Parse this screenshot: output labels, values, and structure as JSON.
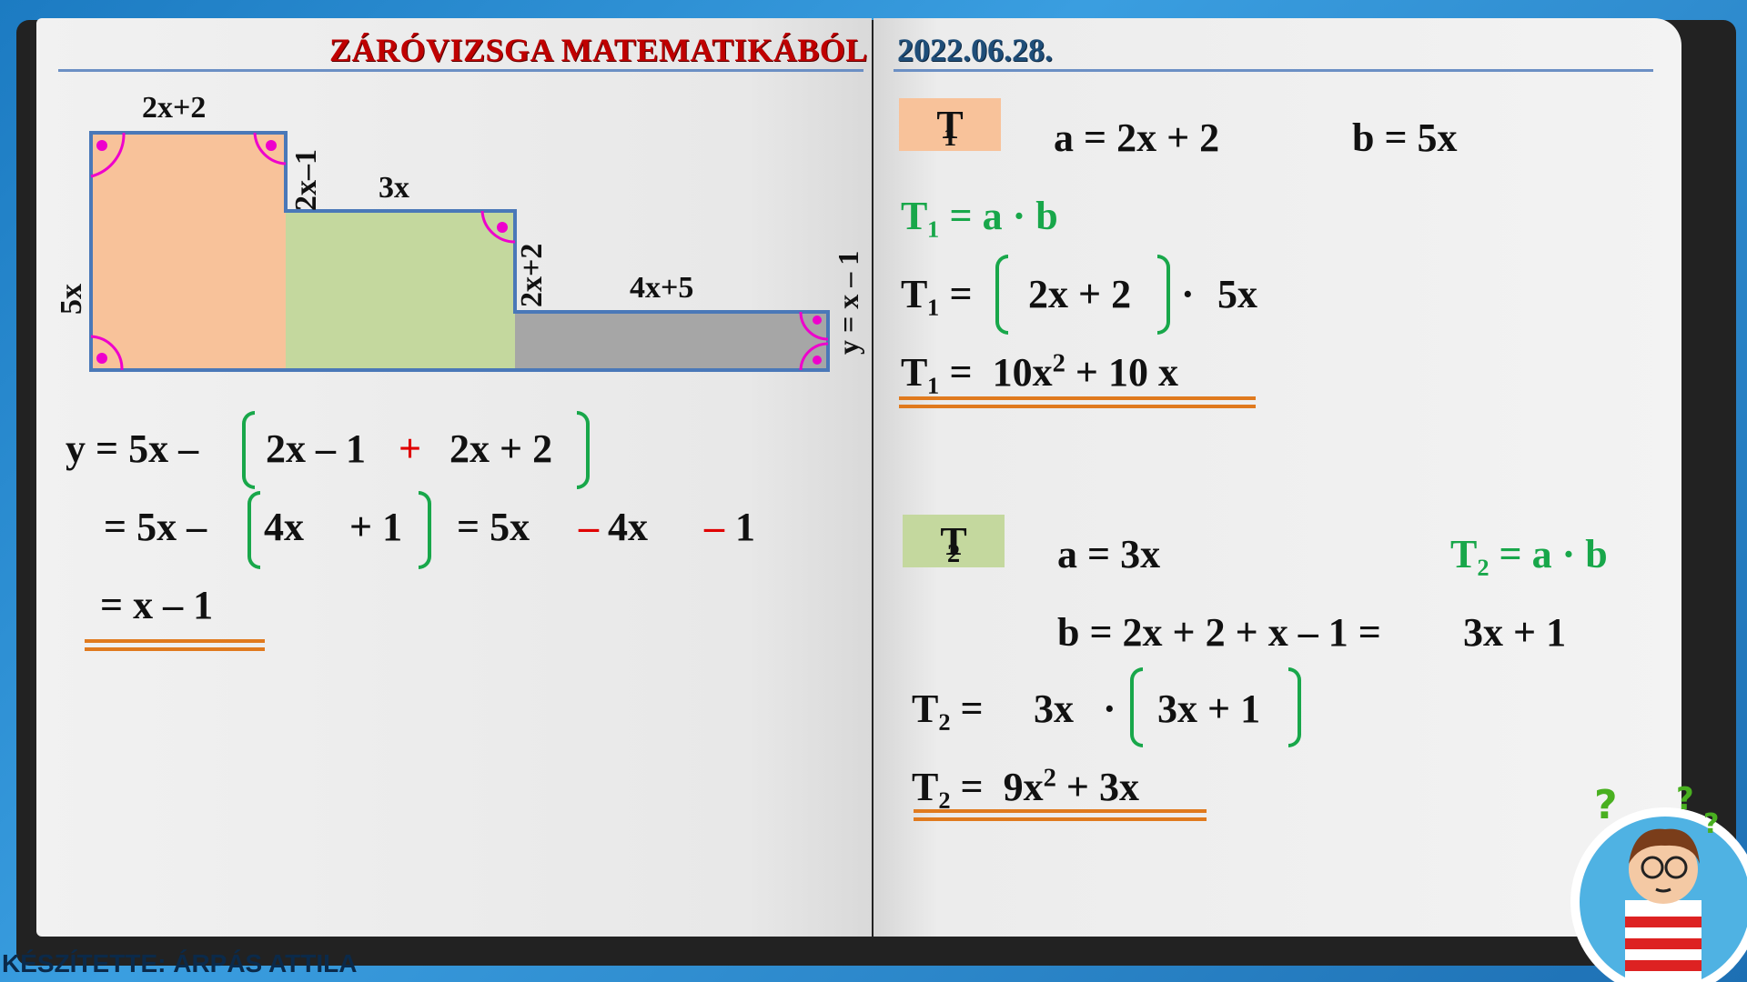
{
  "header": {
    "title": "ZÁRÓVIZSGA MATEMATIKÁBÓL",
    "date": "2022.06.28."
  },
  "figure": {
    "dim_top": "2x+2",
    "dim_step1_vertical": "2x–1",
    "dim_middle": "3x",
    "dim_step2_vertical": "2x+2",
    "dim_right": "4x+5",
    "dim_left": "5x",
    "dim_y": "y =  x – 1",
    "colors": {
      "t1": "#f8c29a",
      "t2": "#c4d89e",
      "t3": "#a6a6a6",
      "outline": "#4a78b8",
      "angle": "#ee00cc"
    }
  },
  "y_calc": {
    "line1": {
      "lhs": "y =  5x –",
      "a": "2x – 1",
      "op": "+",
      "b": "2x + 2"
    },
    "line2": {
      "lhs": "=  5x –",
      "a": "4x",
      "b": "+ 1",
      "eq": "=  5x",
      "m1": "–",
      "c": "4x",
      "m2": "–",
      "d": "1"
    },
    "line3": "=   x  – 1"
  },
  "t1": {
    "label": "T",
    "sub": "1",
    "a": "a = 2x + 2",
    "b": "b = 5x",
    "formula": "T₁ = a · b",
    "step1_lhs": "T₁ =",
    "step1_in": "2x + 2",
    "step1_dot": "·",
    "step1_rhs": "5x",
    "result_lhs": "T₁ =",
    "result_a": "10x",
    "result_exp": "2",
    "result_b": " + 10 x"
  },
  "t2": {
    "label": "T",
    "sub": "2",
    "a": "a = 3x",
    "formula": "T₂ = a · b",
    "b_line": "b = 2x +  2  + x – 1 =",
    "b_result": "3x  + 1",
    "step1_lhs": "T₂ =",
    "step1_a": "3x",
    "step1_dot": "·",
    "step1_in": "3x + 1",
    "result_lhs": "T₂ =",
    "result_a": "9x",
    "result_exp": "2",
    "result_b": " + 3x"
  },
  "footer": "KÉSZÍTETTE: ÁRPÁS ATTILA"
}
